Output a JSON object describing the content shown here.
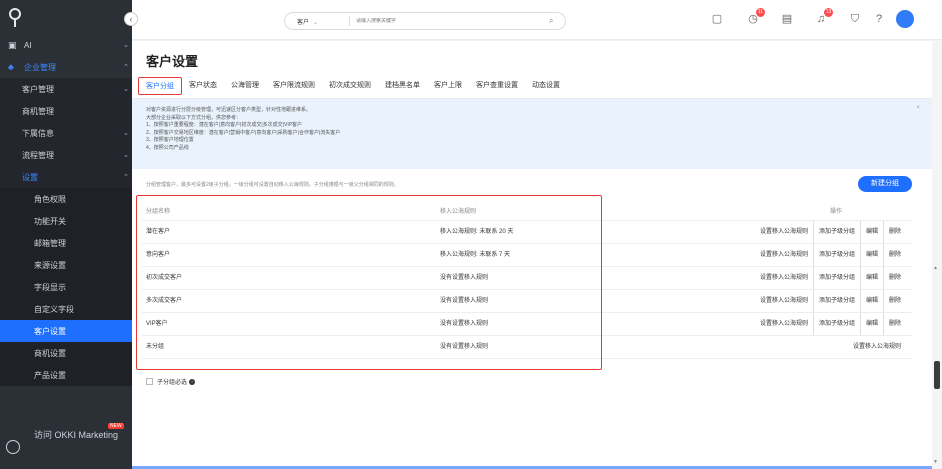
{
  "sidebar": {
    "items": [
      {
        "label": "AI",
        "level": "top",
        "chev": "⌄"
      },
      {
        "label": "企业管理",
        "level": "top",
        "chev": "⌃"
      },
      {
        "label": "客户管理",
        "level": "sub",
        "chev": "⌄"
      },
      {
        "label": "商机管理",
        "level": "sub",
        "chev": ""
      },
      {
        "label": "下属信息",
        "level": "sub",
        "chev": "⌄"
      },
      {
        "label": "流程管理",
        "level": "sub",
        "chev": "⌄"
      },
      {
        "label": "设置",
        "level": "sub",
        "chev": "⌃"
      },
      {
        "label": "角色权限",
        "level": "subsub",
        "chev": ""
      },
      {
        "label": "功能开关",
        "level": "subsub",
        "chev": ""
      },
      {
        "label": "邮箱管理",
        "level": "subsub",
        "chev": ""
      },
      {
        "label": "来源设置",
        "level": "subsub",
        "chev": ""
      },
      {
        "label": "字段显示",
        "level": "subsub",
        "chev": ""
      },
      {
        "label": "自定义字段",
        "level": "subsub",
        "chev": ""
      },
      {
        "label": "客户设置",
        "level": "subsub",
        "chev": ""
      },
      {
        "label": "商机设置",
        "level": "subsub",
        "chev": ""
      },
      {
        "label": "产品设置",
        "level": "subsub",
        "chev": ""
      }
    ],
    "visit_label": "访问 OKKI Marketing",
    "visit_badge": "NEW"
  },
  "topbar": {
    "search_scope": "客户",
    "search_placeholder": "请输入搜索关键字",
    "badges": {
      "clock": "11",
      "bell": "13"
    }
  },
  "page": {
    "title": "客户设置",
    "tabs": [
      "客户分组",
      "客户状态",
      "公海管理",
      "客户限流规则",
      "初次成交规则",
      "建档黑名单",
      "客户上限",
      "客户查重设置",
      "动态设置"
    ],
    "info_lines": [
      "对客户资源进行分层分级管理，可迅速区分客户类型，针对性地跟进维系。",
      "大部分企业采取以下方式分组，供您参考：",
      "1、按照客户重要程度：潜在客户|意向客户|初次成交|多次成交|VIP客户",
      "2、按照客户交易地区维度：潜在客户|营销中客户|意向客户|采购客户|合作客户|流失客户",
      "3、按照客户地理位置",
      "4、按照公司产品线"
    ],
    "note": "分组管理客户，最多可设置2级子分组。一级分组可设置自动移入公海规则，子分组遵循与一级父分组相同的规则。",
    "new_button": "新建分组",
    "table": {
      "headers": {
        "name": "分组名称",
        "rule": "移入公海规则",
        "ops": "操作"
      },
      "rows": [
        {
          "name": "潜在客户",
          "rule": "移入公海规则: 未联系 20 天",
          "ops": [
            "设置移入公海规则",
            "添加子级分组",
            "编辑",
            "删除"
          ]
        },
        {
          "name": "意向客户",
          "rule": "移入公海规则: 未联系 7 天",
          "ops": [
            "设置移入公海规则",
            "添加子级分组",
            "编辑",
            "删除"
          ]
        },
        {
          "name": "初次成交客户",
          "rule": "没有设置移入规则",
          "ops": [
            "设置移入公海规则",
            "添加子级分组",
            "编辑",
            "删除"
          ]
        },
        {
          "name": "多次成交客户",
          "rule": "没有设置移入规则",
          "ops": [
            "设置移入公海规则",
            "添加子级分组",
            "编辑",
            "删除"
          ]
        },
        {
          "name": "VIP客户",
          "rule": "没有设置移入规则",
          "ops": [
            "设置移入公海规则",
            "添加子级分组",
            "编辑",
            "删除"
          ]
        },
        {
          "name": "未分组",
          "rule": "没有设置移入规则",
          "ops": [
            "设置移入公海规则"
          ]
        }
      ]
    },
    "checkbox_label": "子分组必选"
  },
  "colors": {
    "accent": "#1f6fff",
    "highlight": "#e53935",
    "sidebar": "#2b2f36"
  }
}
